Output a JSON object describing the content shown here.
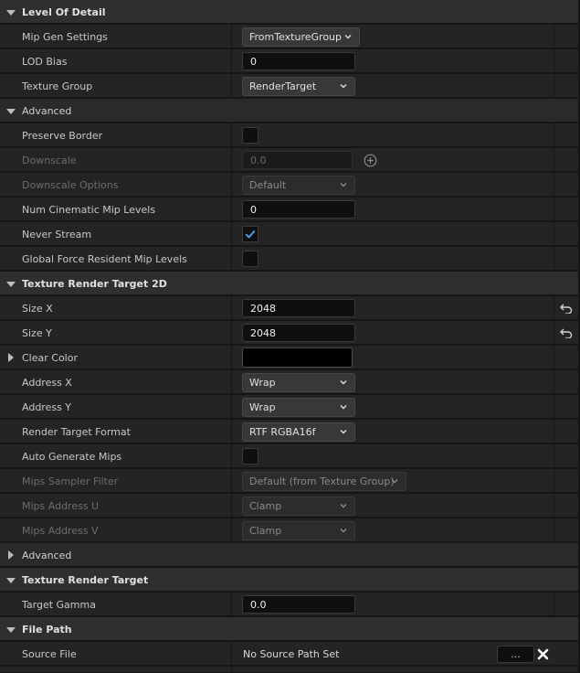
{
  "categories": {
    "level_of_detail": "Level Of Detail",
    "advanced": "Advanced",
    "texture_render_target_2d": "Texture Render Target 2D",
    "advanced_2": "Advanced",
    "texture_render_target": "Texture Render Target",
    "file_path": "File Path"
  },
  "lod": {
    "mip_gen_label": "Mip Gen Settings",
    "mip_gen_value": "FromTextureGroup",
    "lod_bias_label": "LOD Bias",
    "lod_bias_value": "0",
    "texture_group_label": "Texture Group",
    "texture_group_value": "RenderTarget"
  },
  "advanced": {
    "preserve_border_label": "Preserve Border",
    "downscale_label": "Downscale",
    "downscale_value": "0.0",
    "downscale_options_label": "Downscale Options",
    "downscale_options_value": "Default",
    "num_cinematic_label": "Num Cinematic Mip Levels",
    "num_cinematic_value": "0",
    "never_stream_label": "Never Stream",
    "global_force_label": "Global Force Resident Mip Levels"
  },
  "rt2d": {
    "size_x_label": "Size X",
    "size_x_value": "2048",
    "size_y_label": "Size Y",
    "size_y_value": "2048",
    "clear_color_label": "Clear Color",
    "clear_color": "#000000",
    "address_x_label": "Address X",
    "address_x_value": "Wrap",
    "address_y_label": "Address Y",
    "address_y_value": "Wrap",
    "format_label": "Render Target Format",
    "format_value": "RTF RGBA16f",
    "auto_mips_label": "Auto Generate Mips",
    "mips_sampler_label": "Mips Sampler Filter",
    "mips_sampler_value": "Default (from Texture Group)",
    "mips_addr_u_label": "Mips Address U",
    "mips_addr_u_value": "Clamp",
    "mips_addr_v_label": "Mips Address V",
    "mips_addr_v_value": "Clamp"
  },
  "rt": {
    "target_gamma_label": "Target Gamma",
    "target_gamma_value": "0.0"
  },
  "file": {
    "source_file_label": "Source File",
    "source_file_value": "No Source Path Set",
    "browse_label": "..."
  },
  "colors": {
    "accent_check": "#4c9be8"
  }
}
